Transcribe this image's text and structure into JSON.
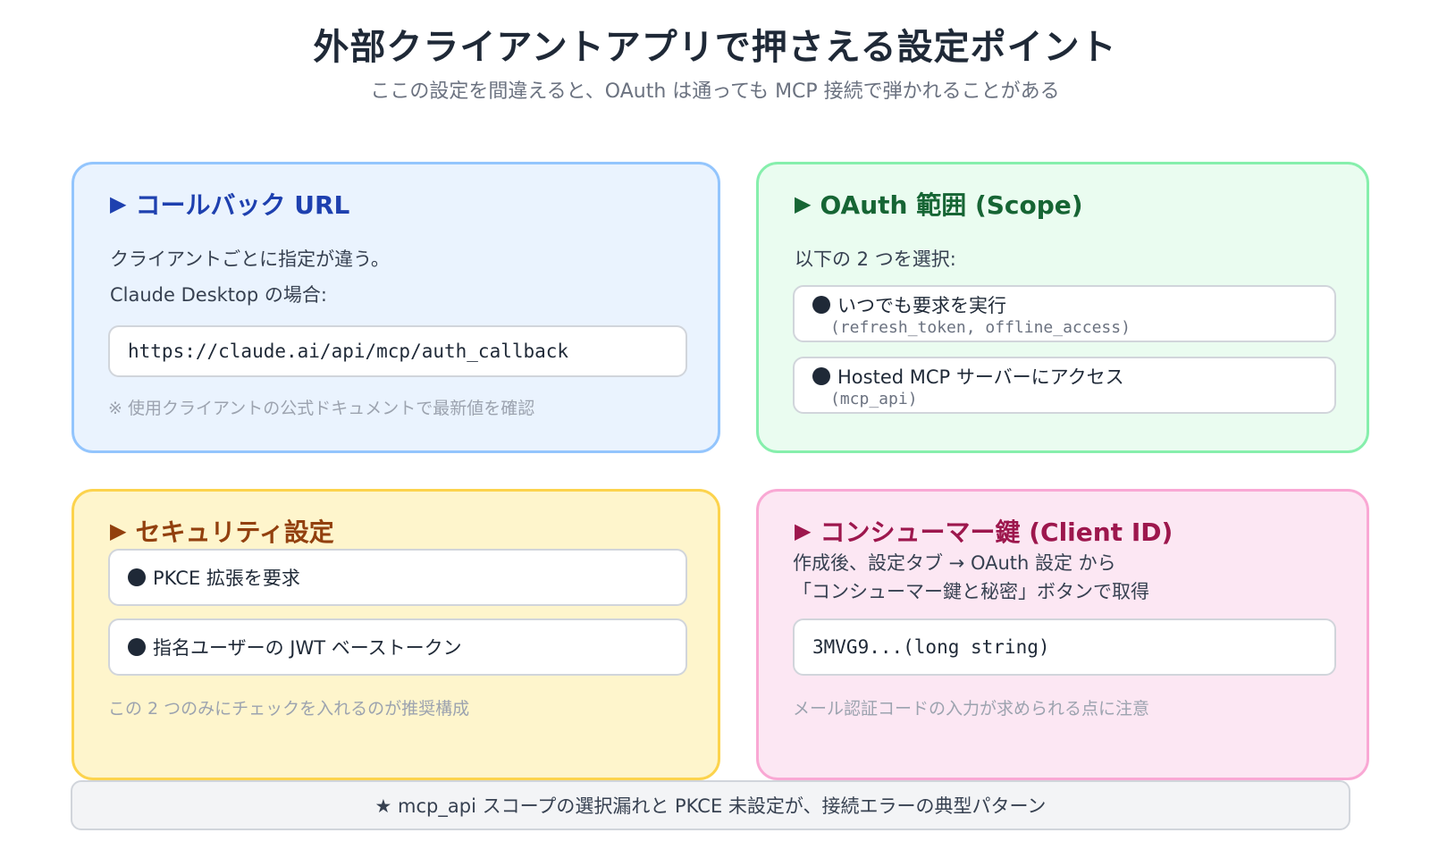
{
  "header": {
    "title": "外部クライアントアプリで押さえる設定ポイント",
    "subtitle": "ここの設定を間違えると、OAuth は通っても MCP 接続で弾かれることがある"
  },
  "cards": {
    "callback": {
      "marker": "▶",
      "title": "コールバック URL",
      "desc1": "クライアントごとに指定が違う。",
      "desc2": "Claude Desktop の場合:",
      "url": "https://claude.ai/api/mcp/auth_callback",
      "note": "※ 使用クライアントの公式ドキュメントで最新値を確認",
      "accent": "#1e40af"
    },
    "scope": {
      "marker": "▶",
      "title": "OAuth 範囲 (Scope)",
      "desc": "以下の 2 つを選択:",
      "items": [
        {
          "label": "いつでも要求を実行",
          "code": "(refresh_token, offline_access)"
        },
        {
          "label": "Hosted MCP サーバーにアクセス",
          "code": "(mcp_api)"
        }
      ],
      "accent": "#166534"
    },
    "security": {
      "marker": "▶",
      "title": "セキュリティ設定",
      "items": [
        {
          "label": "PKCE 拡張を要求"
        },
        {
          "label": "指名ユーザーの JWT ベーストークン"
        }
      ],
      "note": "この 2 つのみにチェックを入れるのが推奨構成",
      "accent": "#92400e"
    },
    "consumer": {
      "marker": "▶",
      "title": "コンシューマー鍵 (Client ID)",
      "desc1": "作成後、設定タブ → OAuth 設定 から",
      "desc2": "「コンシューマー鍵と秘密」ボタンで取得",
      "key": "3MVG9...(long string)",
      "note": "メール認証コードの入力が求められる点に注意",
      "accent": "#9d174d"
    }
  },
  "footer": {
    "text": "★ mcp_api スコープの選択漏れと PKCE 未設定が、接続エラーの典型パターン"
  }
}
